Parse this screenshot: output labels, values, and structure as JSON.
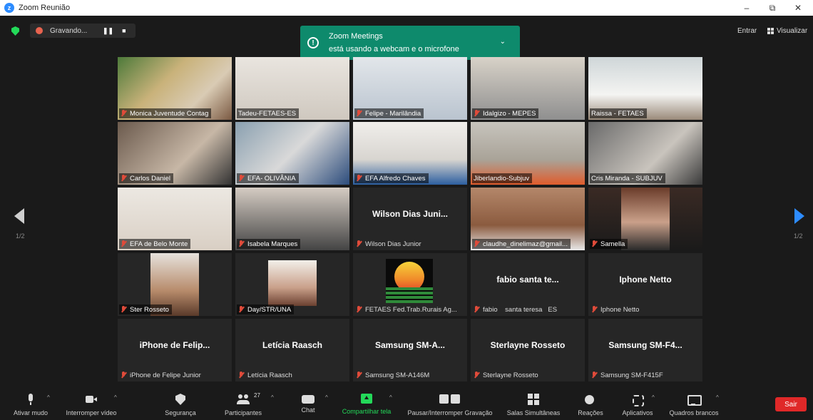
{
  "window": {
    "title": "Zoom Reunião",
    "minimize": "–",
    "restore": "⧉",
    "close": "✕"
  },
  "topbar": {
    "recording_label": "Gravando...",
    "pause_glyph": "❚❚",
    "stop_glyph": "■",
    "notification": {
      "title": "Zoom Meetings",
      "message": "está usando a webcam e o microfone",
      "icon": "info-icon"
    },
    "enter_label": "Entrar",
    "view_label": "Visualizar"
  },
  "pagination": {
    "left_label": "1/2",
    "right_label": "1/2"
  },
  "tiles": [
    {
      "name": "Monica Juventude Contag",
      "muted": true,
      "video": true
    },
    {
      "name": "Tadeu-FETAES-ES",
      "muted": false,
      "video": true
    },
    {
      "name": "Felipe - Marilândia",
      "muted": true,
      "video": true
    },
    {
      "name": "Idalgizo - MEPES",
      "muted": true,
      "video": true
    },
    {
      "name": "Raissa - FETAES",
      "muted": false,
      "video": true
    },
    {
      "name": "Carlos Daniel",
      "muted": true,
      "video": true
    },
    {
      "name": "EFA- OLIVÂNIA",
      "muted": true,
      "video": true
    },
    {
      "name": "EFA Alfredo Chaves",
      "muted": true,
      "video": true
    },
    {
      "name": "Jiberlandio-Subjuv",
      "muted": false,
      "video": true,
      "active": true
    },
    {
      "name": "Cris Miranda - SUBJUV",
      "muted": false,
      "video": true
    },
    {
      "name": "EFA de Belo Monte",
      "muted": true,
      "video": true
    },
    {
      "name": "Isabela Marques",
      "muted": true,
      "video": true
    },
    {
      "name": "Wilson Dias Junior",
      "display": "Wilson Dias Juni...",
      "muted": true,
      "video": false
    },
    {
      "name": "claudhe_dinelimaz@gmail...",
      "muted": true,
      "video": true
    },
    {
      "name": "Samella",
      "muted": true,
      "video": true
    },
    {
      "name": "Ster Rosseto",
      "muted": true,
      "video": true
    },
    {
      "name": "Day/STR/UNA",
      "muted": true,
      "video": true
    },
    {
      "name": "FETAES Fed.Trab.Rurais Ag...",
      "muted": true,
      "video": false,
      "logo": true
    },
    {
      "name": "fabio    santa teresa   ES",
      "display": "fabio    santa te...",
      "muted": true,
      "video": false
    },
    {
      "name": "Iphone Netto",
      "display": "Iphone Netto",
      "muted": true,
      "video": false
    },
    {
      "name": "iPhone de Felipe Junior",
      "display": "iPhone de Felip...",
      "muted": true,
      "video": false
    },
    {
      "name": "Letícia Raasch",
      "display": "Letícia Raasch",
      "muted": true,
      "video": false
    },
    {
      "name": "Samsung SM-A146M",
      "display": "Samsung SM-A...",
      "muted": true,
      "video": false
    },
    {
      "name": "Sterlayne Rosseto",
      "display": "Sterlayne Rosseto",
      "muted": true,
      "video": false
    },
    {
      "name": "Samsung SM-F415F",
      "display": "Samsung SM-F4...",
      "muted": true,
      "video": false
    }
  ],
  "toolbar": {
    "mute": "Ativar mudo",
    "video": "Interromper vídeo",
    "security": "Segurança",
    "participants": "Participantes",
    "participants_count": "27",
    "chat": "Chat",
    "share": "Compartilhar tela",
    "pause_recording": "Pausar/Interromper Gravação",
    "breakout": "Salas Simultâneas",
    "reactions": "Reações",
    "apps": "Aplicativos",
    "whiteboards": "Quadros brancos",
    "leave": "Sair"
  },
  "colors": {
    "accent": "#2d8cff",
    "notification": "#0e8a6c",
    "leave": "#e02828",
    "active_speaker": "#b8e04a",
    "share": "#23d959"
  }
}
